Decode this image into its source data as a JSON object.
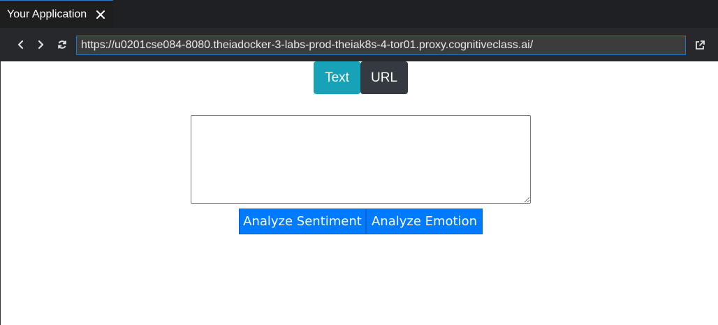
{
  "tab": {
    "title": "Your Application"
  },
  "toolbar": {
    "url": "https://u0201cse084-8080.theiadocker-3-labs-prod-theiak8s-4-tor01.proxy.cognitiveclass.ai/"
  },
  "modes": {
    "text_label": "Text",
    "url_label": "URL"
  },
  "input": {
    "value": "",
    "placeholder": ""
  },
  "actions": {
    "sentiment_label": "Analyze Sentiment",
    "emotion_label": "Analyze Emotion"
  },
  "colors": {
    "text_mode": "#17a2b8",
    "url_mode": "#343a40",
    "action_primary": "#007bff",
    "url_focus_border": "#1b78c9"
  }
}
